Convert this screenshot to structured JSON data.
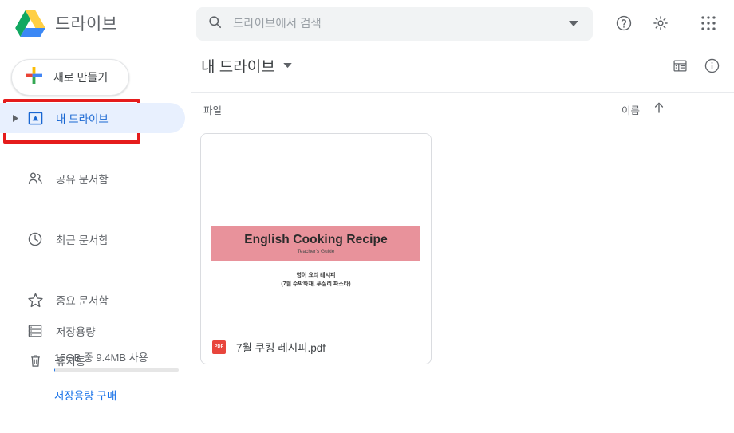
{
  "app": {
    "brand_name": "드라이브",
    "logo_icon": "google-drive-logo"
  },
  "search": {
    "placeholder": "드라이브에서 검색",
    "value": "",
    "search_icon": "search-icon",
    "caret_icon": "chevron-down-icon"
  },
  "topbar_icons": {
    "help": "help-circle-icon",
    "settings": "gear-icon",
    "apps": "apps-grid-icon"
  },
  "sidebar": {
    "new_button": {
      "label": "새로 만들기",
      "icon": "plus-icon"
    },
    "items": [
      {
        "label": "내 드라이브",
        "icon": "drive-triangle-icon",
        "active": true,
        "has_caret": true
      },
      {
        "label": "공유 문서함",
        "icon": "people-icon",
        "active": false,
        "has_caret": false
      },
      {
        "label": "최근 문서함",
        "icon": "clock-icon",
        "active": false,
        "has_caret": false
      },
      {
        "label": "중요 문서함",
        "icon": "star-icon",
        "active": false,
        "has_caret": false
      },
      {
        "label": "휴지통",
        "icon": "trash-icon",
        "active": false,
        "has_caret": false
      }
    ],
    "storage": {
      "label": "저장용량",
      "icon": "storage-drives-icon",
      "usage_text": "15GB 중 9.4MB 사용",
      "percent_used": 0.06,
      "buy_link": "저장용량 구매"
    }
  },
  "main": {
    "breadcrumb": "내 드라이브",
    "breadcrumb_caret": "chevron-down-icon",
    "view_toggle_icon": "list-view-icon",
    "info_icon": "info-circle-icon",
    "columns": {
      "files": "파일",
      "sort_by": "이름",
      "sort_arrow": "arrow-up-icon"
    },
    "files": [
      {
        "name": "7월 쿠킹 레시피.pdf",
        "type_icon": "pdf-icon",
        "type_badge": "PDF",
        "thumbnail": {
          "banner_title": "English Cooking Recipe",
          "banner_subtitle": "Teacher's Guide",
          "line1": "영어 요리 레시피",
          "line2": "(7월 수박화채, 푸실리 파스타)",
          "banner_color": "#e8929b"
        }
      }
    ]
  },
  "annotation": {
    "highlight_color": "#e51c1c",
    "target": "새로 만들기"
  },
  "colors": {
    "accent_blue": "#1a73e8",
    "selected_bg": "#e8f0fe",
    "selected_text": "#1967d2",
    "text_gray": "#5f6368",
    "search_bg": "#f1f3f4"
  }
}
